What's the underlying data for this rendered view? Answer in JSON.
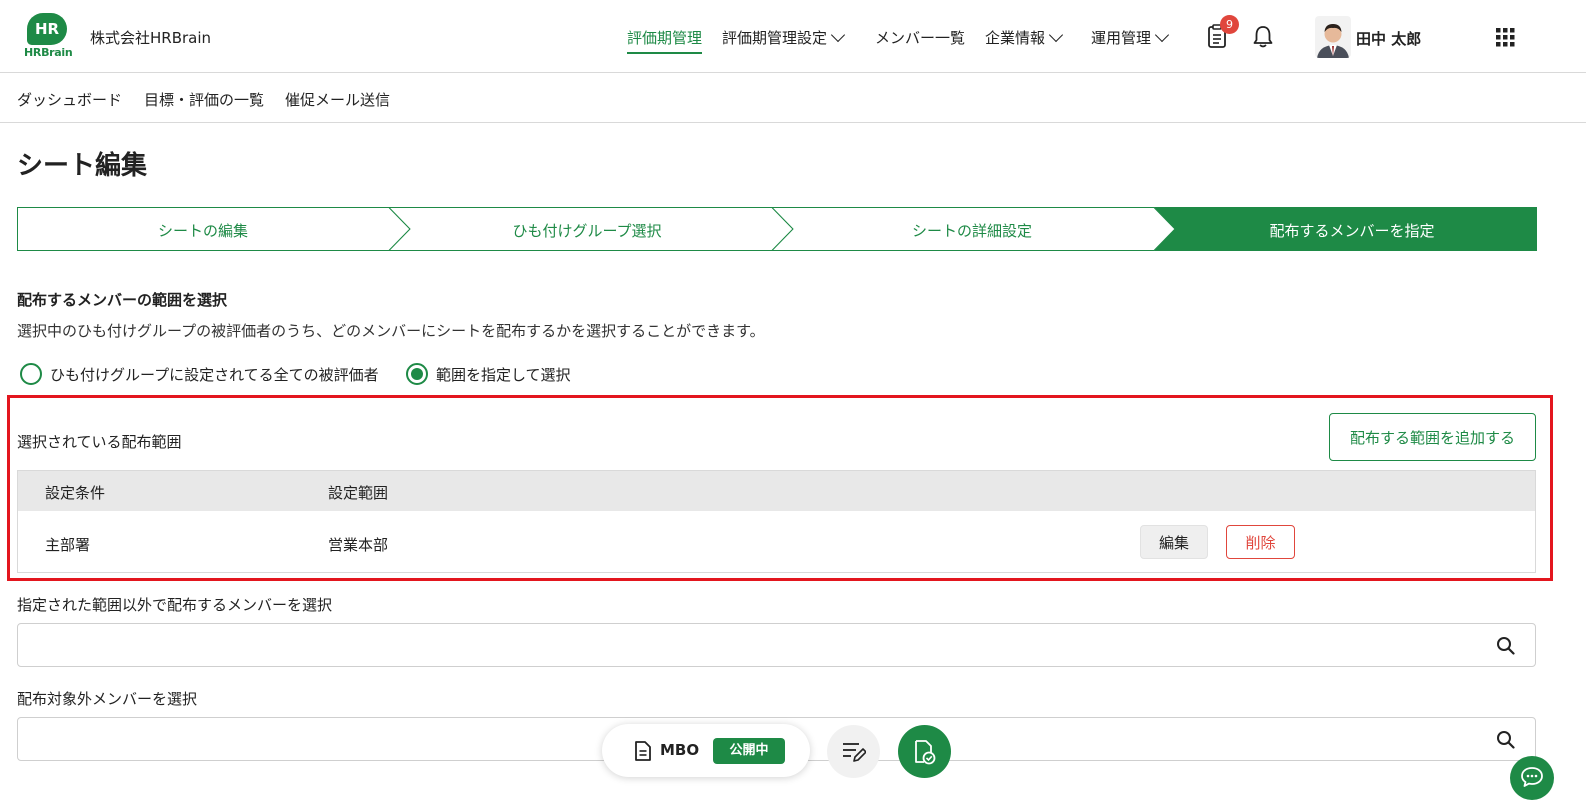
{
  "header": {
    "logo_mark": "HR",
    "logo_word": "HRBrain",
    "company": "株式会社HRBrain",
    "nav": [
      {
        "label": "評価期管理",
        "active": true
      },
      {
        "label": "評価期管理設定",
        "dropdown": true
      },
      {
        "label": "メンバー一覧"
      },
      {
        "label": "企業情報",
        "dropdown": true
      },
      {
        "label": "運用管理",
        "dropdown": true
      }
    ],
    "notification_count": "9",
    "user_name": "田中 太郎"
  },
  "subnav": [
    "ダッシュボード",
    "目標・評価の一覧",
    "催促メール送信"
  ],
  "page_title": "シート編集",
  "steps": [
    {
      "label": "シートの編集",
      "current": false
    },
    {
      "label": "ひも付けグループ選択",
      "current": false
    },
    {
      "label": "シートの詳細設定",
      "current": false
    },
    {
      "label": "配布するメンバーを指定",
      "current": true
    }
  ],
  "section": {
    "title": "配布するメンバーの範囲を選択",
    "description": "選択中のひも付けグループの被評価者のうち、どのメンバーにシートを配布するかを選択することができます。",
    "radio_options": [
      {
        "label": "ひも付けグループに設定されてる全ての被評価者",
        "selected": false
      },
      {
        "label": "範囲を指定して選択",
        "selected": true
      }
    ]
  },
  "range": {
    "label": "選択されている配布範囲",
    "add_button": "配布する範囲を追加する",
    "columns": [
      "設定条件",
      "設定範囲"
    ],
    "rows": [
      {
        "condition": "主部署",
        "scope": "営業本部",
        "edit": "編集",
        "delete": "削除"
      }
    ]
  },
  "extra_members": {
    "label": "指定された範囲以外で配布するメンバーを選択",
    "value": ""
  },
  "excluded_members": {
    "label": "配布対象外メンバーを選択",
    "value": ""
  },
  "floating": {
    "sheet_type": "MBO",
    "status": "公開中"
  },
  "colors": {
    "brand": "#1e8a46",
    "danger": "#e0463c",
    "highlight": "#e3161e"
  }
}
